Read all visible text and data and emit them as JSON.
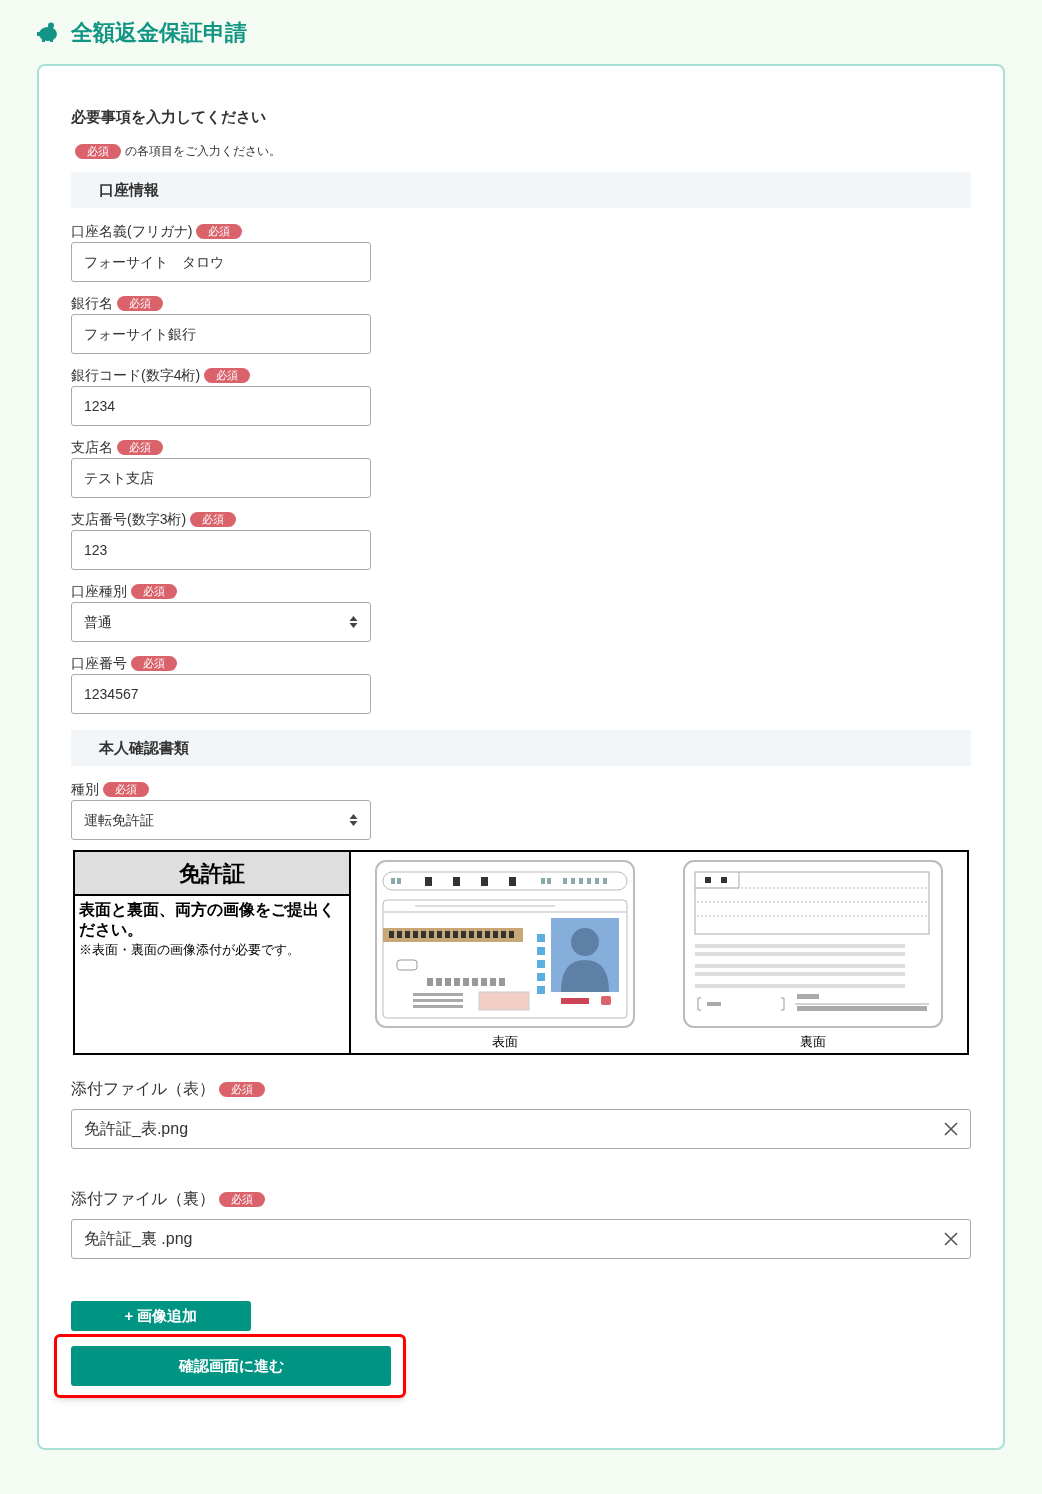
{
  "header": {
    "title": "全額返金保証申請"
  },
  "form": {
    "heading": "必要事項を入力してください",
    "note": {
      "badge": "必須",
      "text": "の各項目をご入力ください。"
    },
    "sections": [
      {
        "title": "口座情報",
        "fields": [
          {
            "label": "口座名義(フリガナ)",
            "badge": "必須",
            "kind": "text",
            "value": "フォーサイト　タロウ"
          },
          {
            "label": "銀行名",
            "badge": "必須",
            "kind": "text",
            "value": "フォーサイト銀行"
          },
          {
            "label": "銀行コード(数字4桁)",
            "badge": "必須",
            "kind": "text",
            "value": "1234"
          },
          {
            "label": "支店名",
            "badge": "必須",
            "kind": "text",
            "value": "テスト支店"
          },
          {
            "label": "支店番号(数字3桁)",
            "badge": "必須",
            "kind": "text",
            "value": "123"
          },
          {
            "label": "口座種別",
            "badge": "必須",
            "kind": "select",
            "value": "普通"
          },
          {
            "label": "口座番号",
            "badge": "必須",
            "kind": "text",
            "value": "1234567"
          }
        ]
      },
      {
        "title": "本人確認書類",
        "fields": [
          {
            "label": "種別",
            "badge": "必須",
            "kind": "select",
            "value": "運転免許証"
          }
        ]
      }
    ]
  },
  "license_guide": {
    "title": "免許証",
    "instruction": "表面と裏面、両方の画像をご提出ください。",
    "note": "※表面・裏面の画像添付が必要です。",
    "images": [
      {
        "caption": "表面",
        "kind": "front"
      },
      {
        "caption": "裏面",
        "kind": "back"
      }
    ]
  },
  "attachments": [
    {
      "label": "添付ファイル（表）",
      "badge": "必須",
      "value": "免許証_表.png"
    },
    {
      "label": "添付ファイル（裏）",
      "badge": "必須",
      "value": "免許証_裏 .png"
    }
  ],
  "add_button": {
    "label": "+ 画像追加"
  },
  "submit_button": {
    "label": "確認画面に進む",
    "highlighted": true
  }
}
